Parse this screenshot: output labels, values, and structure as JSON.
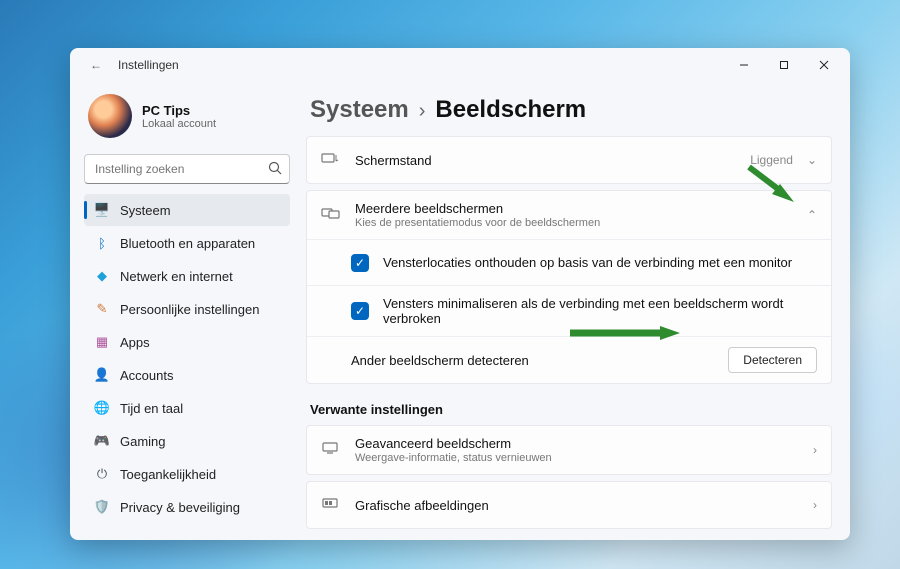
{
  "window": {
    "app_title": "Instellingen",
    "back_glyph": "←"
  },
  "profile": {
    "name": "PC Tips",
    "subtitle": "Lokaal account"
  },
  "search": {
    "placeholder": "Instelling zoeken"
  },
  "nav": [
    {
      "id": "system",
      "icon": "🖥️",
      "icon_color": "#0067c0",
      "label": "Systeem",
      "active": true
    },
    {
      "id": "bluetooth",
      "icon": "ᛒ",
      "icon_color": "#0067c0",
      "label": "Bluetooth en apparaten"
    },
    {
      "id": "network",
      "icon": "◆",
      "icon_color": "#1ea0d9",
      "label": "Netwerk en internet"
    },
    {
      "id": "personal",
      "icon": "✎",
      "icon_color": "#d17a3a",
      "label": "Persoonlijke instellingen"
    },
    {
      "id": "apps",
      "icon": "▦",
      "icon_color": "#b0569e",
      "label": "Apps"
    },
    {
      "id": "accounts",
      "icon": "👤",
      "icon_color": "#8f979e",
      "label": "Accounts"
    },
    {
      "id": "time",
      "icon": "🌐",
      "icon_color": "#2a9d5a",
      "label": "Tijd en taal"
    },
    {
      "id": "gaming",
      "icon": "🎮",
      "icon_color": "#7a8a99",
      "label": "Gaming"
    },
    {
      "id": "access",
      "icon": "⏻",
      "icon_color": "#4a5560",
      "label": "Toegankelijkheid"
    },
    {
      "id": "privacy",
      "icon": "🛡️",
      "icon_color": "#4a5560",
      "label": "Privacy & beveiliging"
    }
  ],
  "breadcrumb": {
    "root": "Systeem",
    "separator": "›",
    "leaf": "Beeldscherm"
  },
  "orientation_row": {
    "label": "Schermstand",
    "value": "Liggend"
  },
  "multi_display": {
    "title": "Meerdere beeldschermen",
    "subtitle": "Kies de presentatiemodus voor de beeldschermen",
    "option1": "Vensterlocaties onthouden op basis van de verbinding met een monitor",
    "option2": "Vensters minimaliseren als de verbinding met een beeldscherm wordt verbroken",
    "detect_label": "Ander beeldscherm detecteren",
    "detect_button": "Detecteren"
  },
  "related": {
    "heading": "Verwante instellingen",
    "advanced_title": "Geavanceerd beeldscherm",
    "advanced_sub": "Weergave-informatie, status vernieuwen",
    "graphics": "Grafische afbeeldingen"
  }
}
